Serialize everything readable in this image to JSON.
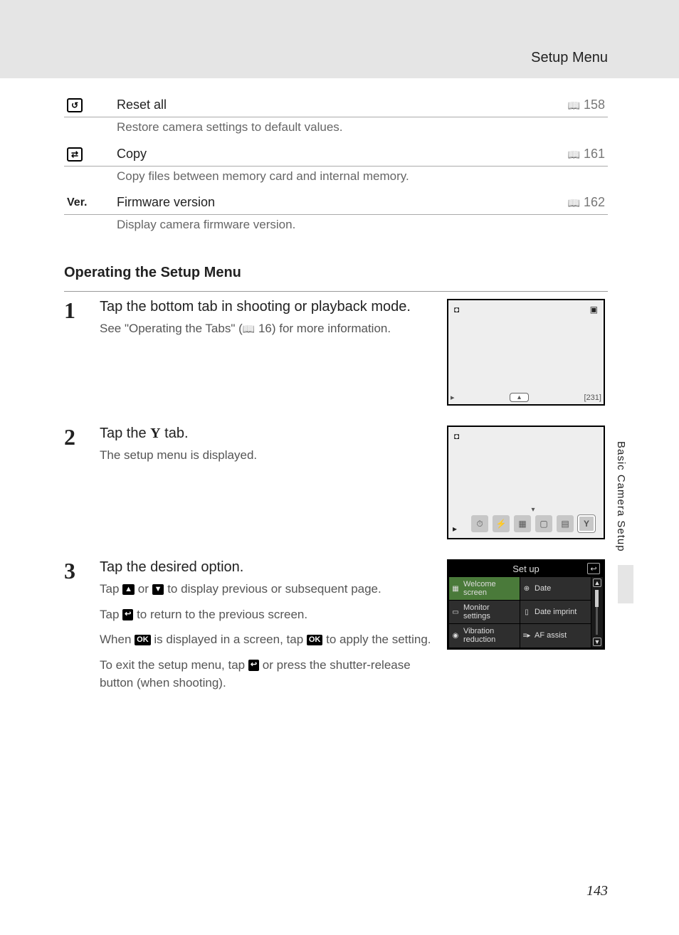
{
  "header": {
    "title": "Setup Menu"
  },
  "side_label": "Basic Camera Setup",
  "page_number": "143",
  "menu_items": [
    {
      "title": "Reset all",
      "desc": "Restore camera settings to default values.",
      "page": "158",
      "icon_label": "reset"
    },
    {
      "title": "Copy",
      "desc": "Copy files between memory card and internal memory.",
      "page": "161",
      "icon_label": "copy"
    },
    {
      "title": "Firmware version",
      "desc": "Display camera firmware version.",
      "page": "162",
      "icon_label": "Ver."
    }
  ],
  "section_heading": "Operating the Setup Menu",
  "steps": {
    "s1": {
      "num": "1",
      "title": "Tap the bottom tab in shooting or playback mode.",
      "desc_prefix": "See \"Operating the Tabs\" (",
      "desc_page": "16",
      "desc_suffix": ") for more information.",
      "fig_counter": "231"
    },
    "s2": {
      "num": "2",
      "title_prefix": "Tap the ",
      "title_suffix": " tab.",
      "desc": "The setup menu is displayed."
    },
    "s3": {
      "num": "3",
      "title": "Tap the desired option.",
      "p1_a": "Tap ",
      "p1_b": " or ",
      "p1_c": " to display previous or subsequent page.",
      "p2_a": "Tap ",
      "p2_b": " to return to the previous screen.",
      "p3_a": "When ",
      "p3_b": " is displayed in a screen, tap ",
      "p3_c": " to apply the setting.",
      "p4_a": "To exit the setup menu, tap ",
      "p4_b": " or press the shutter-release button (when shooting)."
    }
  },
  "setup_screen": {
    "title": "Set up",
    "items": [
      {
        "label": "Welcome screen"
      },
      {
        "label": "Date"
      },
      {
        "label": "Monitor settings"
      },
      {
        "label": "Date imprint"
      },
      {
        "label": "Vibration reduction"
      },
      {
        "label": "AF assist"
      }
    ]
  },
  "icons": {
    "up_arrow": "▲",
    "down_arrow": "▼",
    "back_arrow": "↩",
    "ok": "OK",
    "wrench": "Y"
  }
}
